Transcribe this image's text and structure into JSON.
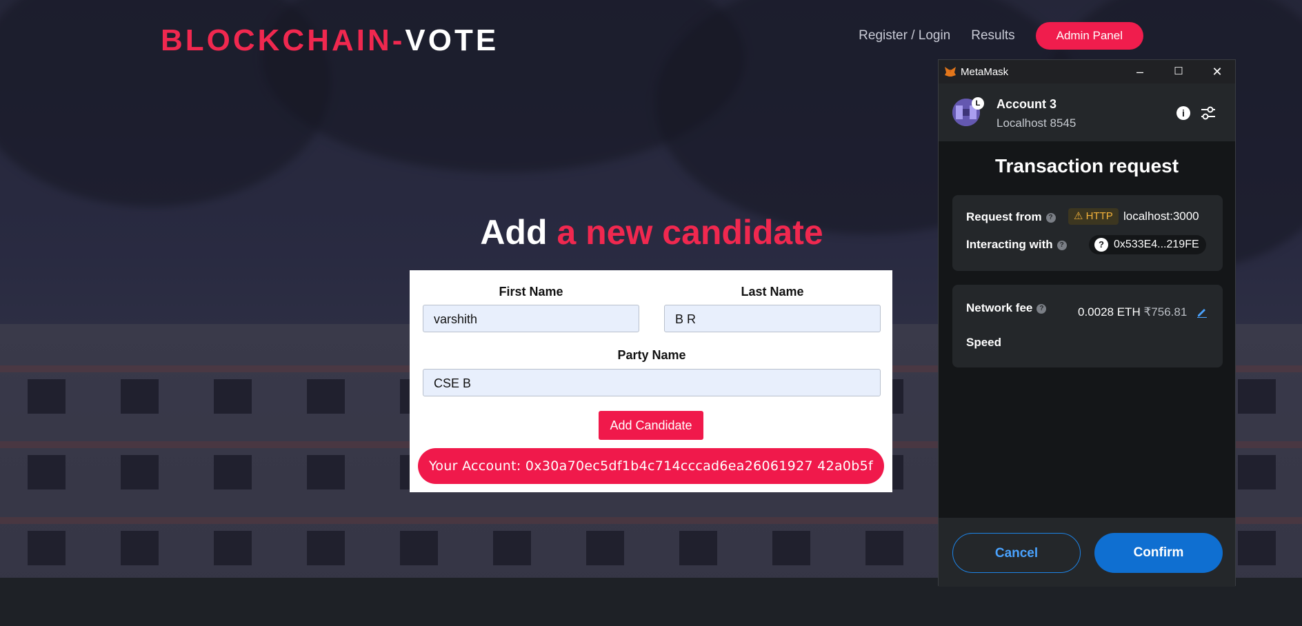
{
  "header": {
    "brand_part1": "BLOCKCHAIN-",
    "brand_part2": "VOTE",
    "nav": {
      "register_login": "Register / Login",
      "results": "Results",
      "admin_panel": "Admin Panel"
    }
  },
  "main": {
    "heading_plain": "Add",
    "heading_accent": "a new candidate",
    "form": {
      "first_name_label": "First Name",
      "first_name_value": "varshith",
      "last_name_label": "Last Name",
      "last_name_value": "B R",
      "party_name_label": "Party Name",
      "party_name_value": "CSE B",
      "add_button": "Add Candidate",
      "account_text": "Your Account: 0x30a70ec5df1b4c714cccad6ea26061927 42a0b5f"
    }
  },
  "metamask": {
    "window_title": "MetaMask",
    "account_name": "Account 3",
    "account_initial": "L",
    "network": "Localhost 8545",
    "title": "Transaction request",
    "request_from_label": "Request from",
    "http_badge": "HTTP",
    "request_host": "localhost:3000",
    "interacting_label": "Interacting with",
    "contract_address": "0x533E4...219FE",
    "network_fee_label": "Network fee",
    "fee_eth": "0.0028 ETH",
    "fee_fiat": "₹756.81",
    "speed_label": "Speed",
    "cancel_button": "Cancel",
    "confirm_button": "Confirm"
  },
  "colors": {
    "accent": "#f0284f",
    "metamask_blue": "#0f6fd1"
  }
}
